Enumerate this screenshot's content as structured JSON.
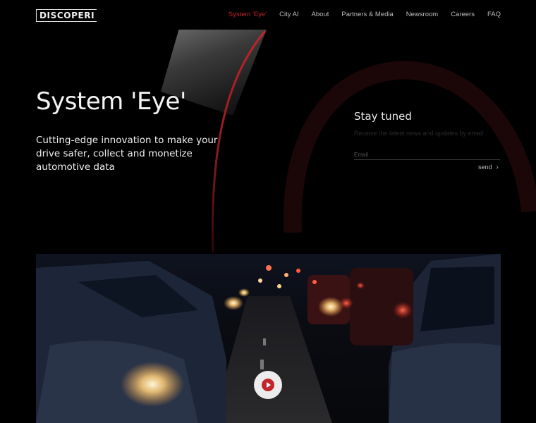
{
  "brand": {
    "logo_text": "DISCOPERI"
  },
  "nav": {
    "items": [
      "System 'Eye'",
      "City AI",
      "About",
      "Partners & Media",
      "Newsroom",
      "Careers",
      "FAQ"
    ],
    "active_index": 0
  },
  "hero": {
    "title": "System 'Eye'",
    "subtitle": "Cutting-edge innovation to make your drive safer, collect and monetize automotive data"
  },
  "subscribe": {
    "title": "Stay tuned",
    "description": "Receive the latest news and updates by email",
    "email_placeholder": "Email",
    "send_label": "send"
  },
  "colors": {
    "accent": "#c0262c",
    "background": "#000000"
  },
  "icons": {
    "send": "chevron-right-icon",
    "video": "play-icon"
  }
}
